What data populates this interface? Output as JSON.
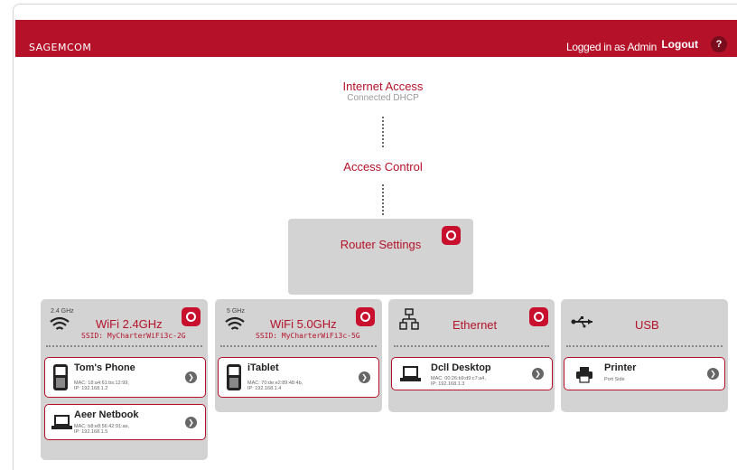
{
  "header": {
    "logo": "SAGEMCOM",
    "login_status": "Logged in as Admin",
    "logout_label": "Logout",
    "help_label": "?"
  },
  "topology": {
    "internet": {
      "title": "Internet Access",
      "status": "Connected DHCP"
    },
    "access_control": {
      "title": "Access Control"
    },
    "router": {
      "title": "Router Settings"
    }
  },
  "panels": {
    "wifi24": {
      "band": "2.4 GHz",
      "title": "WiFi 2.4GHz",
      "ssid": "SSID: MyCharterWiFi3c-2G",
      "devices": [
        {
          "name": "Tom's Phone",
          "mac": "MAC: 18:a4:61:bs:12:99,",
          "ip": "IP: 192.168.1.2"
        },
        {
          "name": "Aeer Netbook",
          "mac": "MAC: b8:e8:56:42:91:ae,",
          "ip": "IP: 192.168.1.5"
        }
      ]
    },
    "wifi5": {
      "band": "5 GHz",
      "title": "WiFi 5.0GHz",
      "ssid": "SSID: MyCharterWiFi3c-5G",
      "devices": [
        {
          "name": "iTablet",
          "mac": "MAC: 70:de:e2:89:48:4b,",
          "ip": "IP: 192.168.1.4"
        }
      ]
    },
    "ethernet": {
      "title": "Ethernet",
      "devices": [
        {
          "name": "Dcll Desktop",
          "mac": "MAC: 00:26:b9:d9:c7:a4,",
          "ip": "IP: 192.168.1.3"
        }
      ]
    },
    "usb": {
      "title": "USB",
      "devices": [
        {
          "name": "Printer",
          "detail": "Port Side"
        }
      ]
    }
  },
  "colors": {
    "brand": "#b5122a",
    "panel": "#d3d3d3"
  }
}
